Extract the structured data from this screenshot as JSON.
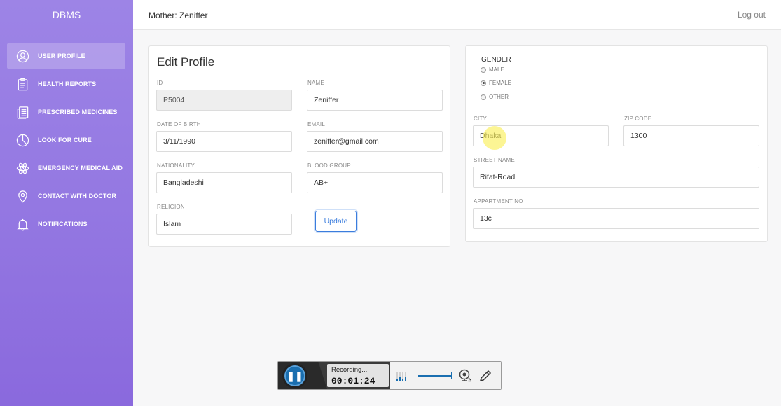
{
  "brand": "DBMS",
  "sidebar": {
    "items": [
      {
        "label": "USER PROFILE",
        "icon": "user-circle-icon",
        "active": true
      },
      {
        "label": "HEALTH REPORTS",
        "icon": "clipboard-icon",
        "active": false
      },
      {
        "label": "PRESCRIBED MEDICINES",
        "icon": "document-list-icon",
        "active": false
      },
      {
        "label": "LOOK FOR CURE",
        "icon": "pie-chart-icon",
        "active": false
      },
      {
        "label": "EMERGENCY MEDICAL AID",
        "icon": "atom-icon",
        "active": false
      },
      {
        "label": "CONTACT WITH DOCTOR",
        "icon": "map-pin-icon",
        "active": false
      },
      {
        "label": "NOTIFICATIONS",
        "icon": "bell-icon",
        "active": false
      }
    ]
  },
  "header": {
    "title": "Mother: Zeniffer",
    "logout": "Log out"
  },
  "edit_profile": {
    "heading": "Edit Profile",
    "id": {
      "label": "ID",
      "value": "P5004"
    },
    "name": {
      "label": "NAME",
      "value": "Zeniffer"
    },
    "dob": {
      "label": "DATE OF BIRTH",
      "value": "3/11/1990"
    },
    "email": {
      "label": "EMAIL",
      "value": "zeniffer@gmail.com"
    },
    "nationality": {
      "label": "NATIONALITY",
      "value": "Bangladeshi"
    },
    "blood_group": {
      "label": "BLOOD GROUP",
      "value": "AB+"
    },
    "religion": {
      "label": "RELIGION",
      "value": "Islam"
    },
    "update_label": "Update"
  },
  "address": {
    "gender_title": "GENDER",
    "gender_options": [
      {
        "label": "MALE",
        "checked": false
      },
      {
        "label": "FEMALE",
        "checked": true
      },
      {
        "label": "OTHER",
        "checked": false
      }
    ],
    "city": {
      "label": "CITY",
      "value": "Dhaka"
    },
    "zip": {
      "label": "ZIP CODE",
      "value": "1300"
    },
    "street": {
      "label": "STREET NAME",
      "value": "Rifat-Road"
    },
    "apartment": {
      "label": "APPARTMENT NO",
      "value": "13c"
    }
  },
  "recorder": {
    "status": "Recording...",
    "elapsed": "00:01:24"
  },
  "colors": {
    "sidebar": "#9478e2",
    "accent": "#3b7ddd",
    "recorder_blue": "#1a6fb0"
  }
}
